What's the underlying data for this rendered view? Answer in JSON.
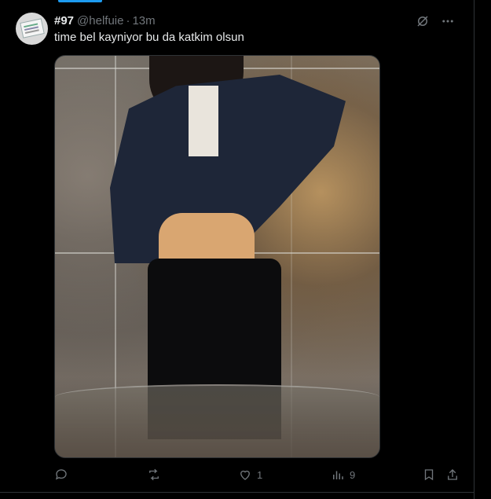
{
  "tweet": {
    "display_name": "#97",
    "handle": "@helfuie",
    "separator": "·",
    "time": "13m",
    "text": "time bel kayniyor bu da katkim olsun",
    "media": {
      "alt_icon": "photo"
    }
  },
  "actions": {
    "reply": {
      "icon": "reply-icon",
      "count": ""
    },
    "retweet": {
      "icon": "retweet-icon",
      "count": ""
    },
    "like": {
      "icon": "heart-icon",
      "count": "1"
    },
    "views": {
      "icon": "views-icon",
      "count": "9"
    },
    "bookmark": {
      "icon": "bookmark-icon"
    },
    "share": {
      "icon": "share-icon"
    }
  },
  "top_icons": [
    "grok-icon",
    "more-icon"
  ],
  "colors": {
    "background": "#000000",
    "text": "#e7e9ea",
    "muted": "#71767b",
    "accent": "#1d9bf0",
    "border": "#2f3336"
  }
}
